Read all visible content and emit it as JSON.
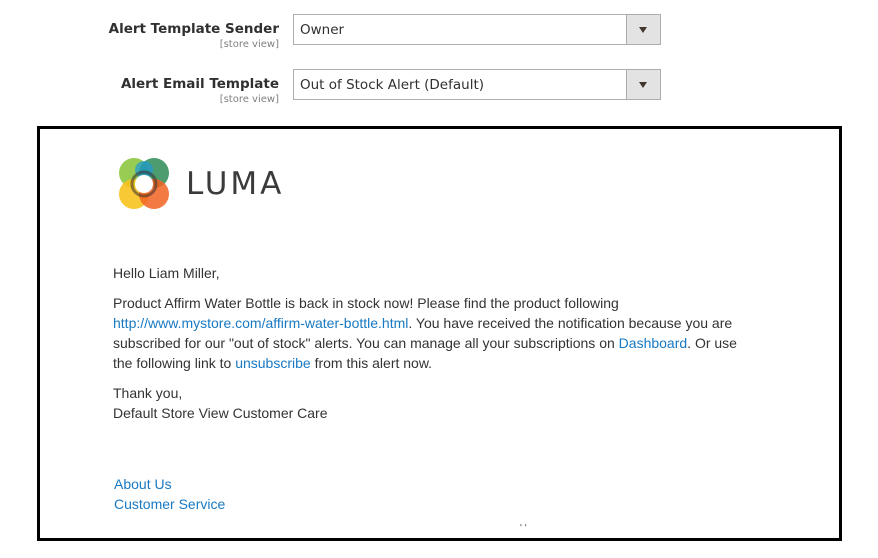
{
  "config": {
    "sender": {
      "label": "Alert Template Sender",
      "scope": "[store view]",
      "value": "Owner"
    },
    "template": {
      "label": "Alert Email Template",
      "scope": "[store view]",
      "value": "Out of Stock Alert (Default)"
    }
  },
  "email": {
    "logo_text": "LUMA",
    "greeting": "Hello Liam Miller,",
    "message": {
      "part1": "Product Affirm Water Bottle is back in stock now! Please find the product following ",
      "product_link": "http://www.mystore.com/affirm-water-bottle.html",
      "part2": ". You have received the notification because you are subscribed for our \"out of stock\" alerts. You can manage all your subscriptions on ",
      "dashboard_link": "Dashboard",
      "part3": ". Or use the following link to ",
      "unsubscribe_link": "unsubscribe",
      "part4": " from this alert now."
    },
    "signoff": {
      "thanks": "Thank you,",
      "team": "Default Store View Customer Care"
    },
    "footer": {
      "about": "About Us",
      "service": "Customer Service"
    },
    "cutoff_text": "' '"
  },
  "colors": {
    "link": "#1979c3",
    "logo_orange": "#f26322",
    "logo_yellow": "#f7c31f",
    "logo_blue": "#1e9bd7",
    "logo_green": "#8dc63f",
    "logo_dark_green": "#2e8b57"
  }
}
